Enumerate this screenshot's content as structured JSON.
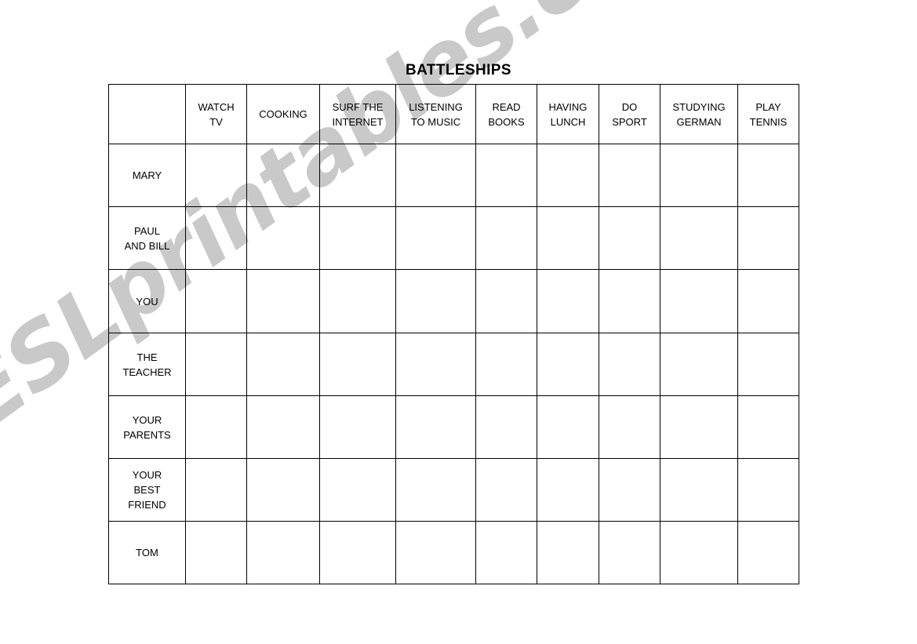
{
  "document": {
    "title": "BATTLESHIPS",
    "watermark": "ESLprintables.com",
    "watermark_color": "#c9c9c9",
    "border_color": "#000000",
    "background_color": "#ffffff"
  },
  "table": {
    "corner_header": "",
    "column_headers": [
      "WATCH\nTV",
      "COOKING",
      "SURF THE\nINTERNET",
      "LISTENING\nTO MUSIC",
      "READ\nBOOKS",
      "HAVING\nLUNCH",
      "DO\nSPORT",
      "STUDYING\nGERMAN",
      "PLAY\nTENNIS"
    ],
    "row_headers": [
      "MARY",
      "PAUL\nAND BILL",
      "YOU",
      "THE\nTEACHER",
      "YOUR\nPARENTS",
      "YOUR\nBEST\nFRIEND",
      "TOM"
    ],
    "cells": [
      [
        "",
        "",
        "",
        "",
        "",
        "",
        "",
        "",
        ""
      ],
      [
        "",
        "",
        "",
        "",
        "",
        "",
        "",
        "",
        ""
      ],
      [
        "",
        "",
        "",
        "",
        "",
        "",
        "",
        "",
        ""
      ],
      [
        "",
        "",
        "",
        "",
        "",
        "",
        "",
        "",
        ""
      ],
      [
        "",
        "",
        "",
        "",
        "",
        "",
        "",
        "",
        ""
      ],
      [
        "",
        "",
        "",
        "",
        "",
        "",
        "",
        "",
        ""
      ],
      [
        "",
        "",
        "",
        "",
        "",
        "",
        "",
        "",
        ""
      ]
    ]
  }
}
